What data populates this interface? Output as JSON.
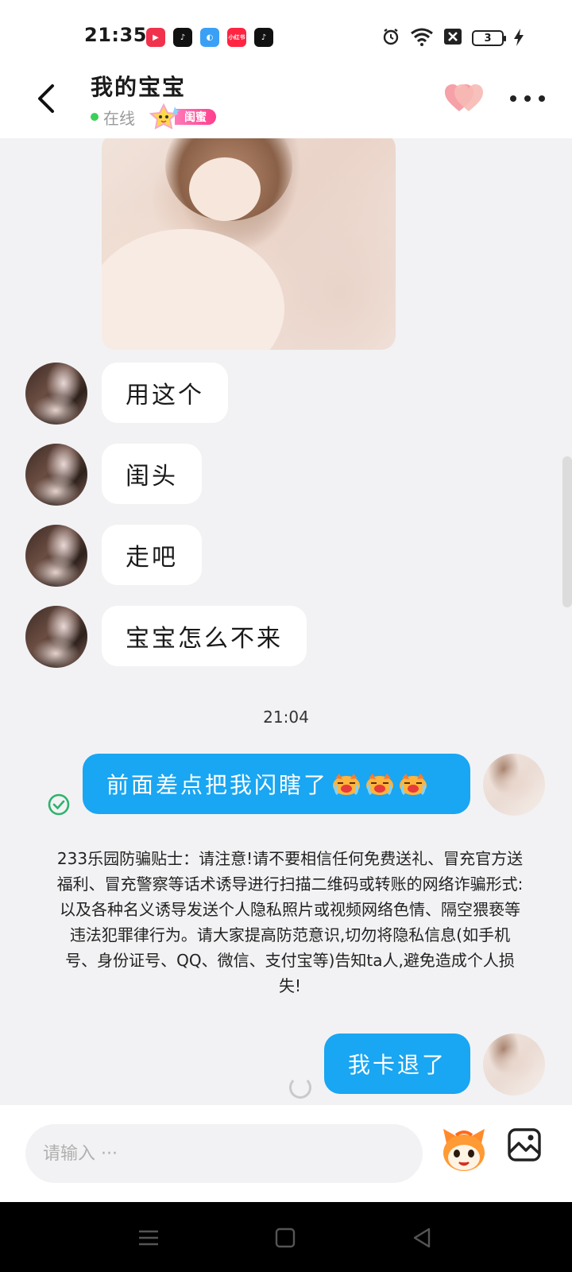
{
  "status_bar": {
    "time": "21:35",
    "app_icons": [
      {
        "name": "video-app-icon",
        "color": "#f0324c",
        "glyph": "▶"
      },
      {
        "name": "tiktok-icon",
        "color": "#111111",
        "glyph": "♪"
      },
      {
        "name": "browser-app-icon",
        "color": "#3aa0f5",
        "glyph": "◐"
      },
      {
        "name": "xiaohongshu-icon",
        "color": "#ff2442",
        "glyph": "小红书"
      },
      {
        "name": "tiktok-lite-icon",
        "color": "#111111",
        "glyph": "♪"
      }
    ],
    "battery_level": "3"
  },
  "header": {
    "contact_name": "我的宝宝",
    "online_status": "在线",
    "relationship_tag": "闺蜜",
    "heart_icon": "hearts-icon",
    "more_icon": "more-dots-icon"
  },
  "messages": {
    "incoming": [
      {
        "text": "用这个"
      },
      {
        "text": "闺头"
      },
      {
        "text": "走吧"
      },
      {
        "text": "宝宝怎么不来"
      }
    ],
    "timestamp": "21:04",
    "outgoing_1": {
      "text": "前面差点把我闪瞎了"
    },
    "notice": "233乐园防骗贴士：请注意!请不要相信任何免费送礼、冒充官方送福利、冒充警察等话术诱导进行扫描二维码或转账的网络诈骗形式:以及各种名义诱导发送个人隐私照片或视频网络色情、隔空猥亵等违法犯罪律行为。请大家提高防范意识,切勿将隐私信息(如手机号、身份证号、QQ、微信、支付宝等)告知ta人,避免造成个人损失!",
    "outgoing_2": {
      "text": "我卡退了"
    }
  },
  "input": {
    "placeholder": "请输入 ···"
  },
  "colors": {
    "outgoing_bubble": "#19a6f2",
    "online_dot": "#3ccf5a",
    "tag_pink": "#ff3e8d"
  }
}
